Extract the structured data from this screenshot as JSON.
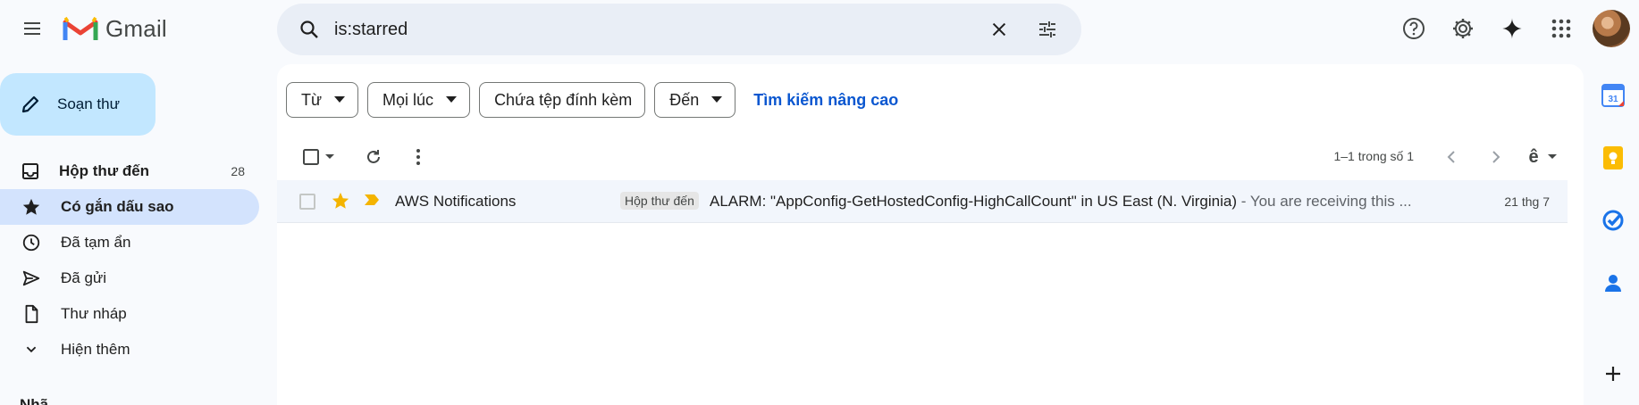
{
  "app": {
    "name": "Gmail"
  },
  "search": {
    "value": "is:starred"
  },
  "compose": {
    "label": "Soạn thư"
  },
  "nav": {
    "items": [
      {
        "label": "Hộp thư đến",
        "count": "28"
      },
      {
        "label": "Có gắn dấu sao"
      },
      {
        "label": "Đã tạm ẩn"
      },
      {
        "label": "Đã gửi"
      },
      {
        "label": "Thư nháp"
      },
      {
        "label": "Hiện thêm"
      }
    ],
    "section_label": "Nhã"
  },
  "filters": {
    "chips": [
      {
        "label": "Từ"
      },
      {
        "label": "Mọi lúc"
      },
      {
        "label": "Chứa tệp đính kèm"
      },
      {
        "label": "Đến"
      }
    ],
    "advanced_link": "Tìm kiếm nâng cao"
  },
  "toolbar": {
    "pager": "1–1 trong số 1",
    "input_tools_glyph": "ê"
  },
  "emails": [
    {
      "sender": "AWS Notifications",
      "label": "Hộp thư đến",
      "subject": "ALARM: \"AppConfig-GetHostedConfig-HighCallCount\" in US East (N. Virginia)",
      "snippet": " - You are receiving this ...",
      "date": "21 thg 7",
      "starred": true
    }
  ],
  "side_panel": {
    "apps": [
      "calendar-icon",
      "keep-icon",
      "tasks-icon",
      "contacts-icon",
      "add-icon"
    ],
    "calendar_day": "31"
  },
  "colors": {
    "accent": "#0b57d0",
    "compose_bg": "#c2e7ff",
    "active_nav": "#d3e3fd",
    "star": "#f4b400",
    "search_bg": "#e9eef6"
  }
}
